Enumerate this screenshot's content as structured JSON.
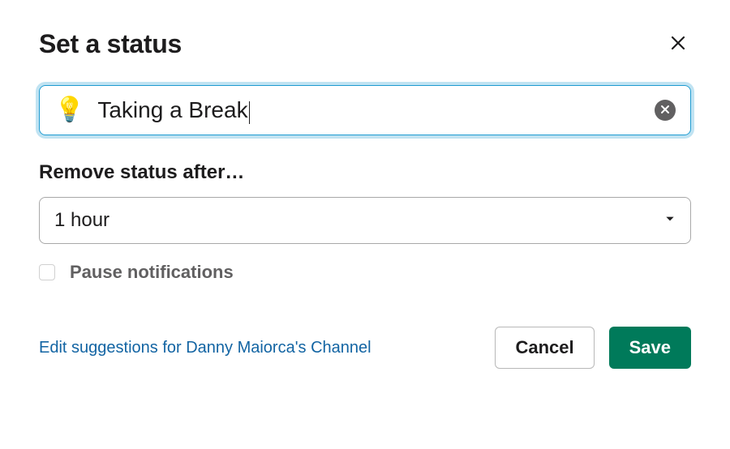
{
  "dialog": {
    "title": "Set a status"
  },
  "status": {
    "emoji": "💡",
    "text": "Taking a Break"
  },
  "remove_after": {
    "label": "Remove status after…",
    "selected": "1 hour"
  },
  "pause": {
    "label": "Pause notifications",
    "checked": false
  },
  "footer": {
    "link": "Edit suggestions for Danny Maiorca's Channel",
    "cancel": "Cancel",
    "save": "Save"
  }
}
